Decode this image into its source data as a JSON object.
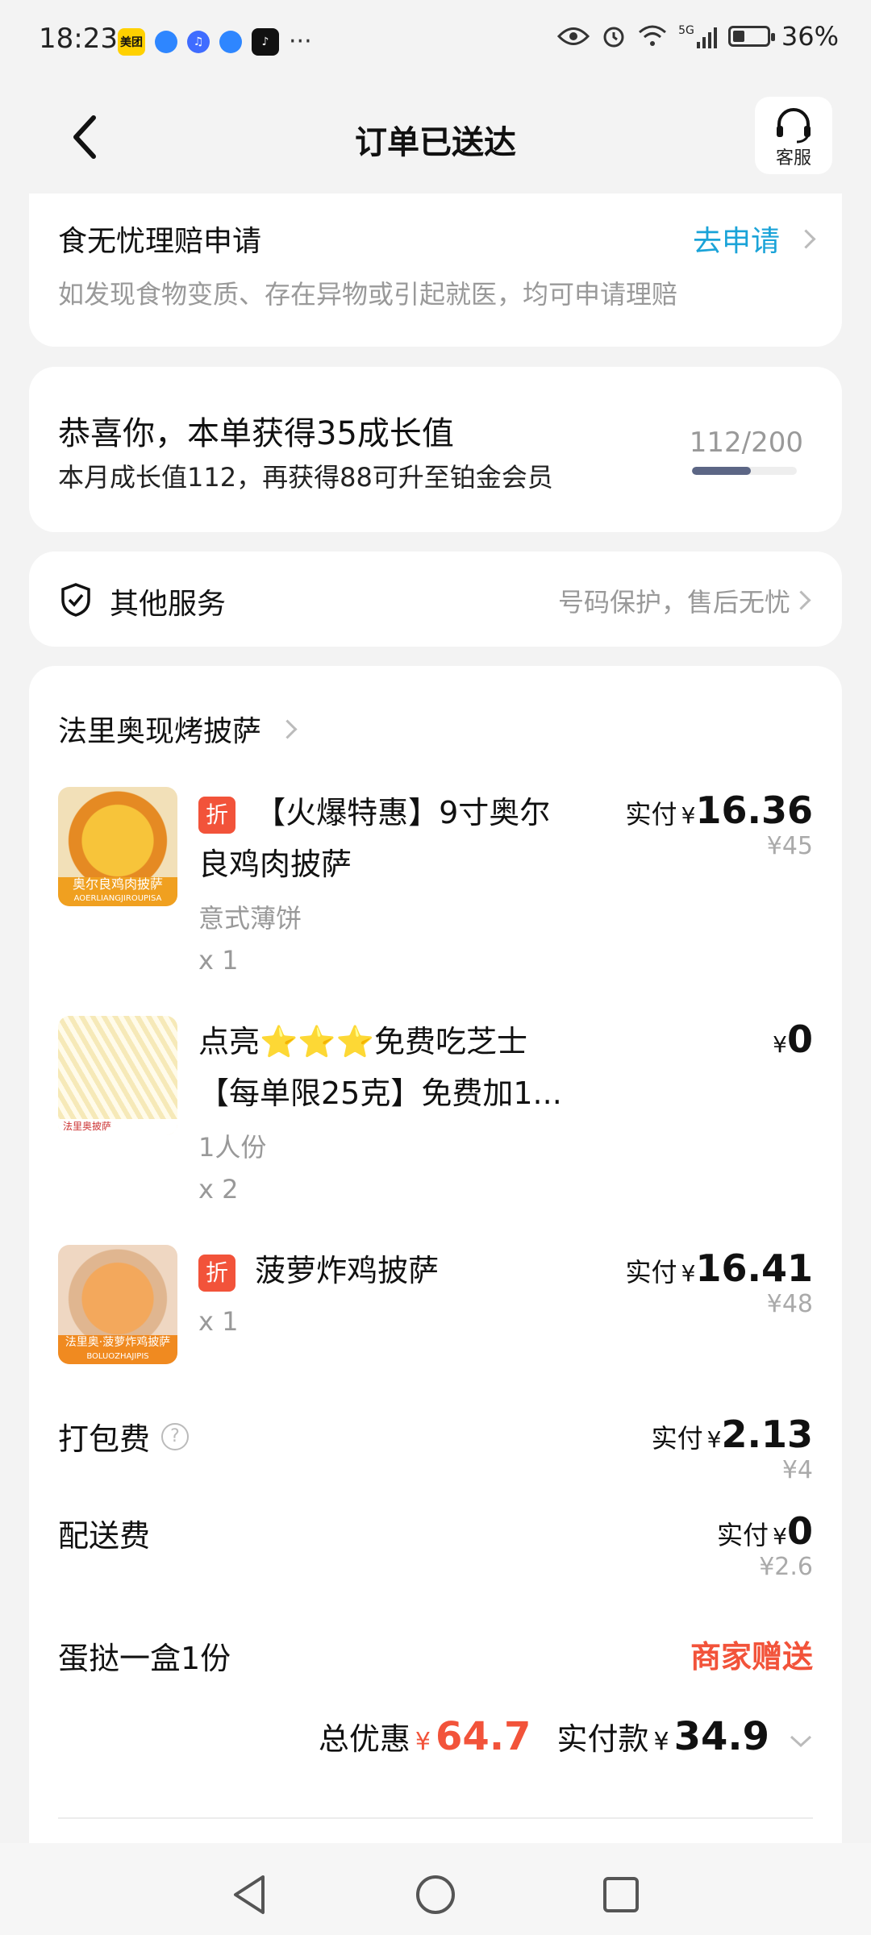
{
  "status": {
    "time": "18:23",
    "battery": "36%",
    "network": "5G"
  },
  "header": {
    "title": "订单已送达",
    "service_label": "客服"
  },
  "claim": {
    "title": "食无忧理赔申请",
    "link": "去申请",
    "desc": "如发现食物变质、存在异物或引起就医，均可申请理赔"
  },
  "growth": {
    "title": "恭喜你，本单获得35成长值",
    "desc": "本月成长值112，再获得88可升至铂金会员",
    "progress_text": "112/200",
    "progress_value": 112,
    "progress_max": 200
  },
  "services": {
    "title": "其他服务",
    "desc": "号码保护，售后无忧"
  },
  "shop": {
    "name": "法里奥现烤披萨"
  },
  "items": [
    {
      "tag": "折",
      "name_line1": "【火爆特惠】9寸奥尔",
      "name_line2": "良鸡肉披萨",
      "spec": "意式薄饼",
      "qty": "x 1",
      "price_label": "实付",
      "currency": "¥",
      "price": "16.36",
      "orig": "¥45",
      "thumb_text": "奥尔良鸡肉披萨",
      "thumb_sub": "AOERLIANGJIROUPISA"
    },
    {
      "name_line1": "点亮⭐⭐⭐免费吃芝士",
      "name_line2": "【每单限25克】免费加1...",
      "spec": "1人份",
      "qty": "x 2",
      "currency": "¥",
      "price": "0",
      "thumb_text": "法里奥披萨"
    },
    {
      "tag": "折",
      "name_line1": "菠萝炸鸡披萨",
      "qty": "x 1",
      "price_label": "实付",
      "currency": "¥",
      "price": "16.41",
      "orig": "¥48",
      "thumb_text": "法里奥·菠萝炸鸡披萨",
      "thumb_sub": "BOLUOZHAJIPIS"
    }
  ],
  "fees": [
    {
      "label": "打包费",
      "price_label": "实付",
      "currency": "¥",
      "price": "2.13",
      "orig": "¥4"
    },
    {
      "label": "配送费",
      "price_label": "实付",
      "currency": "¥",
      "price": "0",
      "orig": "¥2.6"
    }
  ],
  "gift": {
    "label": "蛋挞一盒1份",
    "value": "商家赠送"
  },
  "summary": {
    "discount_label": "总优惠",
    "discount_currency": "¥",
    "discount": "64.7",
    "paid_label": "实付款",
    "paid_currency": "¥",
    "paid": "34.9"
  },
  "colors": {
    "accent": "#1aa3d8",
    "red": "#f2533a",
    "background": "#f3f3f3"
  }
}
